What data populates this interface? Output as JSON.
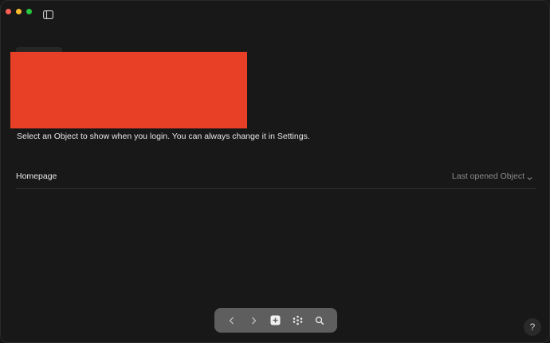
{
  "window": {
    "controls": [
      "close",
      "minimize",
      "zoom"
    ]
  },
  "main": {
    "subtitle": "Select an Object to show when you login. You can always change it in Settings.",
    "homepage_row": {
      "label": "Homepage",
      "value": "Last opened Object"
    }
  },
  "navbar": {
    "items": [
      {
        "name": "back",
        "icon": "chevron-left-icon"
      },
      {
        "name": "forward",
        "icon": "chevron-right-icon"
      },
      {
        "name": "create",
        "icon": "plus-square-icon"
      },
      {
        "name": "graph",
        "icon": "graph-dots-icon"
      },
      {
        "name": "search",
        "icon": "search-icon"
      }
    ]
  },
  "help": {
    "label": "?"
  },
  "colors": {
    "background": "#181818",
    "redaction": "#e84027",
    "navbar": "#5e5e5e",
    "text_primary": "#e6e6e6",
    "text_muted": "#8c8c8c"
  }
}
